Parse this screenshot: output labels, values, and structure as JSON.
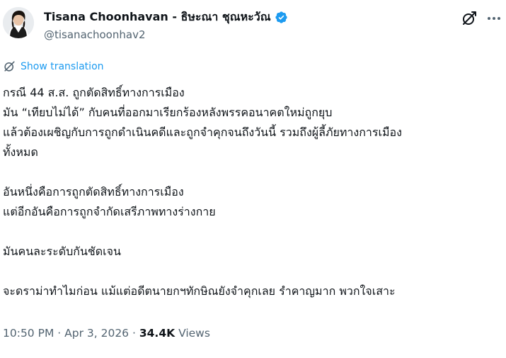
{
  "author": {
    "display_name": "Tisana Choonhavan - ธิษะณา ชุณหะวัณ",
    "handle": "@tisanachoonhav2",
    "verified": true
  },
  "actions": {
    "grok_icon": "grok-icon",
    "more_icon": "more-icon"
  },
  "translate": {
    "label": "Show translation"
  },
  "tweet": {
    "lines": [
      "กรณี 44 ส.ส. ถูกตัดสิทธิ์ทางการเมือง",
      "มัน “เทียบไม่ได้” กับคนที่ออกมาเรียกร้องหลังพรรคอนาคตใหม่ถูกยุบ",
      "แล้วต้องเผชิญกับการถูกดำเนินคดีและถูกจำคุกจนถึงวันนี้ รวมถึงผู้ลี้ภัยทางการเมือง",
      "ทั้งหมด",
      "",
      "อันหนึ่งคือการถูกตัดสิทธิ์ทางการเมือง",
      "แต่อีกอันคือการถูกจำกัดเสรีภาพทางร่างกาย",
      "",
      "มันคนละระดับกันชัดเจน",
      "",
      "จะดราม่าทำไมก่อน แม้แต่อดีตนายกฯทักษิณยังจำคุกเลย รำคาญมาก พวกใจเสาะ"
    ]
  },
  "meta": {
    "time": "10:50 PM",
    "separator": "·",
    "date": "Apr 3, 2026",
    "views_count": "34.4K",
    "views_label": "Views"
  },
  "colors": {
    "text": "#0f1419",
    "secondary": "#536471",
    "link": "#1d9bf0",
    "verified": "#1d9bf0"
  }
}
